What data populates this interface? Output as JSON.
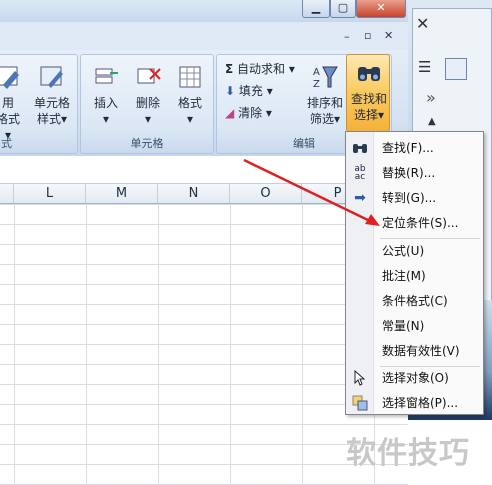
{
  "ribbon": {
    "partial_left_top": "用",
    "partial_left_bottom": "格式",
    "cell_style_top": "单元格",
    "cell_style_bottom": "样式",
    "left_group_label": "式",
    "insert": "插入",
    "delete": "删除",
    "format": "格式",
    "cells_group_label": "单元格",
    "autosum": "自动求和",
    "fill": "填充",
    "clear": "清除",
    "sort_filter_top": "排序和",
    "sort_filter_bottom": "筛选",
    "find_select_top": "查找和",
    "find_select_bottom": "选择",
    "editing_group_label": "编辑",
    "help_glyph": "?"
  },
  "columns": [
    "L",
    "M",
    "N",
    "O",
    "P"
  ],
  "menu": {
    "items": [
      {
        "label": "查找(F)...",
        "icon": "binoculars-icon"
      },
      {
        "label": "替换(R)...",
        "icon": "replace-icon"
      },
      {
        "label": "转到(G)...",
        "icon": "goto-arrow-icon"
      },
      {
        "label": "定位条件(S)...",
        "icon": ""
      },
      {
        "label": "公式(U)",
        "icon": ""
      },
      {
        "label": "批注(M)",
        "icon": ""
      },
      {
        "label": "条件格式(C)",
        "icon": ""
      },
      {
        "label": "常量(N)",
        "icon": ""
      },
      {
        "label": "数据有效性(V)",
        "icon": ""
      },
      {
        "label": "选择对象(O)",
        "icon": "select-objects-icon"
      },
      {
        "label": "选择窗格(P)...",
        "icon": "selection-pane-icon"
      }
    ]
  },
  "watermark": "软件技巧",
  "colors": {
    "arrow": "#e02020",
    "find_highlight": "#f9c95e"
  }
}
